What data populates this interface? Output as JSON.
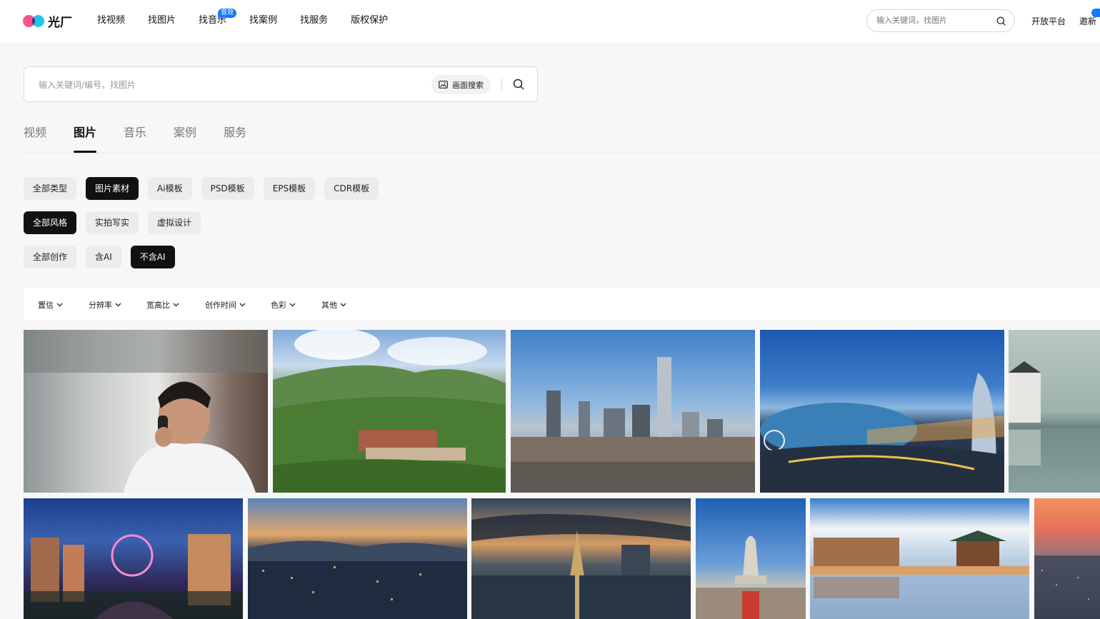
{
  "brand": {
    "name": "光厂"
  },
  "nav": [
    {
      "label": "找视频"
    },
    {
      "label": "找图片"
    },
    {
      "label": "找音乐",
      "badge": "音效"
    },
    {
      "label": "找案例"
    },
    {
      "label": "找服务"
    },
    {
      "label": "版权保护"
    }
  ],
  "top_search": {
    "placeholder": "输入关键词，找图片"
  },
  "top_links": {
    "open_platform": "开放平台",
    "invite": "邀新"
  },
  "main_search": {
    "placeholder": "输入关键词/编号，找图片",
    "image_search_label": "画面搜索"
  },
  "tabs": [
    {
      "label": "视频",
      "active": false
    },
    {
      "label": "图片",
      "active": true
    },
    {
      "label": "音乐",
      "active": false
    },
    {
      "label": "案例",
      "active": false
    },
    {
      "label": "服务",
      "active": false
    }
  ],
  "type_chips": [
    {
      "label": "全部类型",
      "active": false
    },
    {
      "label": "图片素材",
      "active": true
    },
    {
      "label": "Ai模板",
      "active": false
    },
    {
      "label": "PSD模板",
      "active": false
    },
    {
      "label": "EPS模板",
      "active": false
    },
    {
      "label": "CDR模板",
      "active": false
    }
  ],
  "style_chips": [
    {
      "label": "全部风格",
      "active": true
    },
    {
      "label": "实拍写实",
      "active": false
    },
    {
      "label": "虚拟设计",
      "active": false
    }
  ],
  "ai_chips": [
    {
      "label": "全部创作",
      "active": false
    },
    {
      "label": "含AI",
      "active": false
    },
    {
      "label": "不含AI",
      "active": true
    }
  ],
  "filters": [
    {
      "label": "置信"
    },
    {
      "label": "分辨率"
    },
    {
      "label": "宽高比"
    },
    {
      "label": "创作时间"
    },
    {
      "label": "色彩"
    },
    {
      "label": "其他"
    }
  ],
  "colors": {
    "accent": "#1677ff",
    "active_chip": "#111111",
    "logo_pink": "#ff4f8a",
    "logo_cyan": "#25c4e6"
  },
  "images": [
    {
      "subject": "man-on-phone"
    },
    {
      "subject": "mountain-temple"
    },
    {
      "subject": "city-skyline-day"
    },
    {
      "subject": "city-lake-night"
    },
    {
      "subject": "misty-village"
    },
    {
      "subject": "ferris-wheel-night"
    },
    {
      "subject": "harbor-city-dusk"
    },
    {
      "subject": "sunset-skyline"
    },
    {
      "subject": "statue"
    },
    {
      "subject": "drum-tower-reflection"
    },
    {
      "subject": "sunset-aerial"
    }
  ]
}
